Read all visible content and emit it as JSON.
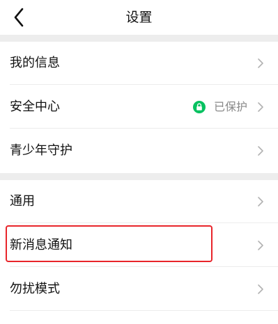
{
  "header": {
    "title": "设置",
    "back_icon": "chevron-left-icon"
  },
  "groups": [
    {
      "items": [
        {
          "label": "我的信息"
        },
        {
          "label": "安全中心",
          "status": "已保护",
          "status_icon": "lock-icon",
          "status_color": "#07c160"
        },
        {
          "label": "青少年守护"
        }
      ]
    },
    {
      "items": [
        {
          "label": "通用"
        },
        {
          "label": "新消息通知",
          "highlighted": true
        },
        {
          "label": "勿扰模式"
        }
      ]
    }
  ],
  "colors": {
    "highlight": "#e8242a",
    "background_gap": "#ededed",
    "text": "#111111",
    "secondary_text": "#888888",
    "chevron": "#b2b2b2"
  }
}
